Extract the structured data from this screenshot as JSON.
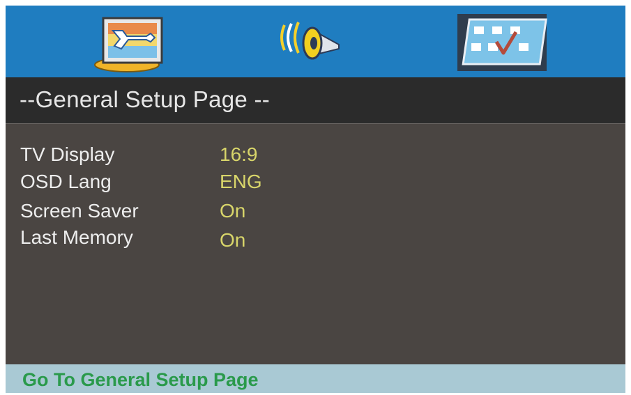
{
  "tabs": [
    {
      "name": "general-setup",
      "icon": "tools-picture-icon",
      "selected": true
    },
    {
      "name": "audio-setup",
      "icon": "speaker-icon",
      "selected": false
    },
    {
      "name": "preference-setup",
      "icon": "checklist-board-icon",
      "selected": false
    }
  ],
  "page": {
    "title": "--General Setup Page --"
  },
  "settings": [
    {
      "label": "TV Display",
      "value": "16:9"
    },
    {
      "label": "OSD Lang",
      "value": "ENG"
    },
    {
      "label": "Screen Saver",
      "value": "On"
    },
    {
      "label": "Last Memory",
      "value": "On"
    }
  ],
  "status": {
    "text": "Go To General Setup Page"
  },
  "colors": {
    "tab_bar": "#1f7dc0",
    "title_bar": "#2b2b2b",
    "body": "#4a4542",
    "label_text": "#ededed",
    "value_text": "#d8d56a",
    "status_bar": "#a9c9d4",
    "status_text": "#2a9a4b"
  }
}
